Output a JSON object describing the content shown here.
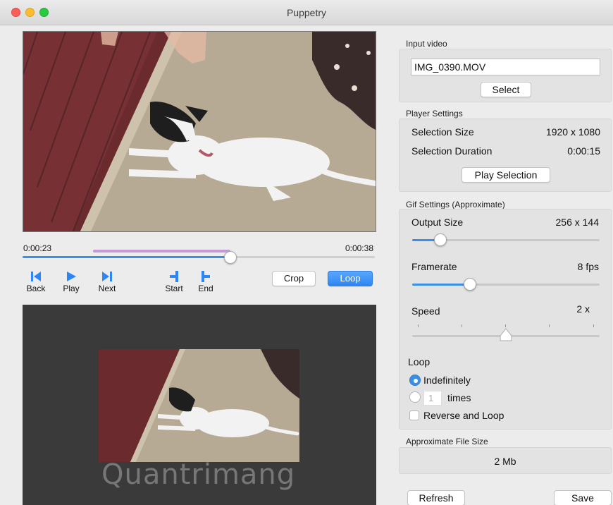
{
  "window": {
    "title": "Puppetry"
  },
  "player": {
    "time_start": "0:00:23",
    "time_end": "0:00:38",
    "progress_fraction": 0.59,
    "selection_start_fraction": 0.2,
    "selection_end_fraction": 0.59,
    "controls": [
      {
        "name": "back",
        "label": "Back",
        "icon": "skip-back-icon"
      },
      {
        "name": "play",
        "label": "Play",
        "icon": "play-icon"
      },
      {
        "name": "next",
        "label": "Next",
        "icon": "skip-forward-icon"
      },
      {
        "name": "start",
        "label": "Start",
        "icon": "mark-start-icon"
      },
      {
        "name": "end",
        "label": "End",
        "icon": "mark-end-icon"
      }
    ],
    "crop_label": "Crop",
    "loop_label": "Loop"
  },
  "watermark": "Quantrimang",
  "input_video": {
    "section_label": "Input video",
    "file_name": "IMG_0390.MOV",
    "select_label": "Select"
  },
  "player_settings": {
    "section_label": "Player Settings",
    "selection_size_label": "Selection Size",
    "selection_size_value": "1920 x 1080",
    "selection_duration_label": "Selection Duration",
    "selection_duration_value": "0:00:15",
    "play_selection_label": "Play Selection"
  },
  "gif_settings": {
    "section_label": "Gif Settings (Approximate)",
    "output_size_label": "Output Size",
    "output_size_value": "256  x  144",
    "output_size_fraction": 0.15,
    "framerate_label": "Framerate",
    "framerate_value": "8  fps",
    "framerate_fraction": 0.31,
    "speed_label": "Speed",
    "speed_value": "2  x",
    "speed_fraction": 0.5,
    "loop_label": "Loop",
    "loop_indefinitely_label": "Indefinitely",
    "loop_times_placeholder": "1",
    "loop_times_label": "times",
    "reverse_label": "Reverse and Loop"
  },
  "file_size": {
    "section_label": "Approximate File Size",
    "value": "2 Mb"
  },
  "footer": {
    "refresh_label": "Refresh",
    "save_label": "Save"
  },
  "colors": {
    "accent": "#3a8fe6",
    "selection": "#c49ad6"
  }
}
